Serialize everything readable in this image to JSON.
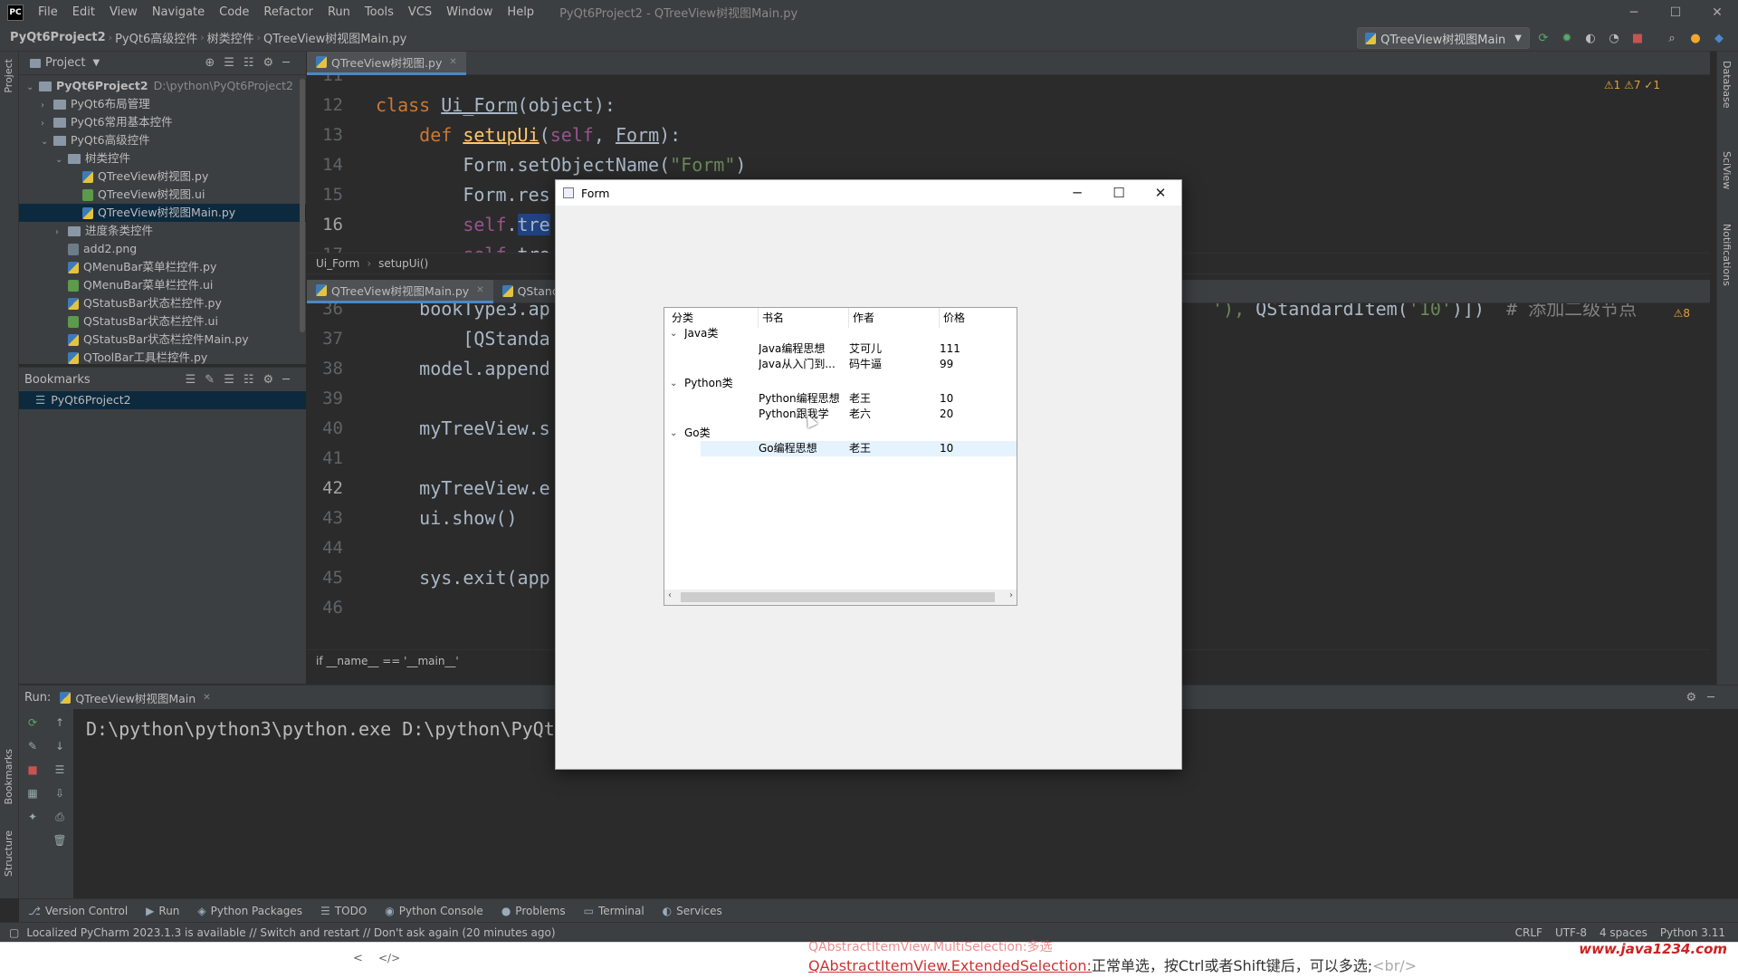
{
  "app": {
    "logo": "PC",
    "menus": [
      "File",
      "Edit",
      "View",
      "Navigate",
      "Code",
      "Refactor",
      "Run",
      "Tools",
      "VCS",
      "Window",
      "Help"
    ],
    "window_title": "PyQt6Project2 - QTreeView树视图Main.py"
  },
  "nav": {
    "breadcrumbs": [
      "PyQt6Project2",
      "PyQt6高级控件",
      "树类控件",
      "QTreeView树视图Main.py"
    ],
    "run_config": "QTreeView树视图Main"
  },
  "left_strip": {
    "project": "Project",
    "bookmarks": "Bookmarks",
    "structure": "Structure"
  },
  "right_strip": {
    "database": "Database",
    "sciview": "SciView",
    "notifications": "Notifications"
  },
  "project_panel": {
    "title": "Project",
    "items": [
      {
        "label": "PyQt6Project2",
        "extra": "D:\\python\\PyQt6Project2",
        "indent": 0,
        "type": "folder",
        "chev": "v"
      },
      {
        "label": "PyQt6布局管理",
        "indent": 1,
        "type": "folder",
        "chev": ">"
      },
      {
        "label": "PyQt6常用基本控件",
        "indent": 1,
        "type": "folder",
        "chev": ">"
      },
      {
        "label": "PyQt6高级控件",
        "indent": 1,
        "type": "folder",
        "chev": "v"
      },
      {
        "label": "树类控件",
        "indent": 2,
        "type": "folder",
        "chev": "v"
      },
      {
        "label": "QTreeView树视图.py",
        "indent": 3,
        "type": "py",
        "chev": ""
      },
      {
        "label": "QTreeView树视图.ui",
        "indent": 3,
        "type": "ui",
        "chev": ""
      },
      {
        "label": "QTreeView树视图Main.py",
        "indent": 3,
        "type": "py",
        "chev": "",
        "selected": true
      },
      {
        "label": "进度条类控件",
        "indent": 2,
        "type": "folder",
        "chev": ">"
      },
      {
        "label": "add2.png",
        "indent": 2,
        "type": "png",
        "chev": ""
      },
      {
        "label": "QMenuBar菜单栏控件.py",
        "indent": 2,
        "type": "py",
        "chev": ""
      },
      {
        "label": "QMenuBar菜单栏控件.ui",
        "indent": 2,
        "type": "ui",
        "chev": ""
      },
      {
        "label": "QStatusBar状态栏控件.py",
        "indent": 2,
        "type": "py",
        "chev": ""
      },
      {
        "label": "QStatusBar状态栏控件.ui",
        "indent": 2,
        "type": "ui",
        "chev": ""
      },
      {
        "label": "QStatusBar状态栏控件Main.py",
        "indent": 2,
        "type": "py",
        "chev": ""
      },
      {
        "label": "QToolBar工具栏控件.py",
        "indent": 2,
        "type": "py",
        "chev": ""
      }
    ]
  },
  "bookmarks": {
    "title": "Bookmarks",
    "items": [
      "PyQt6Project2"
    ]
  },
  "editor_top": {
    "tab": "QTreeView树视图.py",
    "lines": [
      {
        "n": "11",
        "html": ""
      },
      {
        "n": "12",
        "html": "<span class='kw'>class </span><span class='plain' style='text-decoration:underline'>Ui_Form</span><span class='plain'>(object):</span>"
      },
      {
        "n": "13",
        "html": "&nbsp;&nbsp;&nbsp;&nbsp;<span class='kw'>def </span><span class='fn' style='text-decoration:underline'>setupUi</span><span class='plain'>(</span><span class='self'>self</span><span class='plain'>, </span><span class='plain' style='text-decoration:underline'>Form</span><span class='plain'>):</span>"
      },
      {
        "n": "14",
        "html": "&nbsp;&nbsp;&nbsp;&nbsp;&nbsp;&nbsp;&nbsp;&nbsp;<span class='plain'>Form.setObjectName(</span><span class='str'>\"Form\"</span><span class='plain'>)</span>"
      },
      {
        "n": "15",
        "html": "&nbsp;&nbsp;&nbsp;&nbsp;&nbsp;&nbsp;&nbsp;&nbsp;<span class='plain'>Form.res</span>"
      },
      {
        "n": "16",
        "html": "&nbsp;&nbsp;&nbsp;&nbsp;&nbsp;&nbsp;&nbsp;&nbsp;<span class='self'>self</span><span class='plain'>.</span><span class='plain' style='background:#214283'>tre</span>"
      },
      {
        "n": "17",
        "html": "&nbsp;&nbsp;&nbsp;&nbsp;&nbsp;&nbsp;&nbsp;&nbsp;<span class='self'>self</span><span class='plain'>.tre</span>"
      }
    ],
    "crumbs": [
      "Ui_Form",
      "setupUi()"
    ],
    "inspections": "⚠1 ⚠7 ✓1"
  },
  "editor_bottom": {
    "tabs": [
      "QTreeView树视图Main.py",
      "QStanda"
    ],
    "lines": [
      {
        "n": "36",
        "html": "&nbsp;&nbsp;&nbsp;&nbsp;<span class='plain'>bookType3.ap</span>"
      },
      {
        "n": "37",
        "html": "&nbsp;&nbsp;&nbsp;&nbsp;&nbsp;&nbsp;&nbsp;&nbsp;<span class='plain'>[QStanda</span>"
      },
      {
        "n": "38",
        "html": "&nbsp;&nbsp;&nbsp;&nbsp;<span class='plain'>model.append</span>"
      },
      {
        "n": "39",
        "html": ""
      },
      {
        "n": "40",
        "html": "&nbsp;&nbsp;&nbsp;&nbsp;<span class='plain'>myTreeView.s</span>"
      },
      {
        "n": "41",
        "html": ""
      },
      {
        "n": "42",
        "html": "&nbsp;&nbsp;&nbsp;&nbsp;<span class='plain'>myTreeView.e</span>"
      },
      {
        "n": "43",
        "html": "&nbsp;&nbsp;&nbsp;&nbsp;<span class='plain'>ui.show()</span>"
      },
      {
        "n": "44",
        "html": ""
      },
      {
        "n": "45",
        "html": "&nbsp;&nbsp;&nbsp;&nbsp;<span class='plain'>sys.exit(app</span>"
      },
      {
        "n": "46",
        "html": ""
      }
    ],
    "right_code": "<span class='str'>'),</span><span class='plain'> QStandardItem(</span><span class='str'>'10'</span><span class='plain'>)])&nbsp;&nbsp;</span><span class='cm'># 添加二级节点</span>",
    "footer_crumb": "if __name__ == '__main__'",
    "inspections": "⚠8"
  },
  "run_panel": {
    "label": "Run:",
    "tab": "QTreeView树视图Main",
    "output": "D:\\python\\python3\\python.exe D:\\python\\PyQt"
  },
  "bottom_tabs": [
    "Version Control",
    "Run",
    "Python Packages",
    "TODO",
    "Python Console",
    "Problems",
    "Terminal",
    "Services"
  ],
  "status": {
    "message": "Localized PyCharm 2023.1.3 is available // Switch and restart // Don't ask again (20 minutes ago)",
    "right": [
      "CRLF",
      "UTF-8",
      "4 spaces",
      "Python 3.11"
    ]
  },
  "browser": {
    "text_main": "QAbstractItemView.ExtendedSelection:",
    "text_rest": "正常单选，按Ctrl或者Shift键后，可以多选;",
    "text_tag": "<br/>",
    "top_hint": "QAbstractItemView.MultiSelection:多选",
    "watermark": "www.java1234.com",
    "nav_left": "<",
    "nav_code": "</>"
  },
  "form_window": {
    "title": "Form",
    "headers": [
      "分类",
      "书名",
      "作者",
      "价格"
    ],
    "rows": [
      {
        "level": 0,
        "expander": "v",
        "cat": "Java类",
        "book": "",
        "author": "",
        "price": ""
      },
      {
        "level": 1,
        "cat": "",
        "book": "Java编程思想",
        "author": "艾可儿",
        "price": "111"
      },
      {
        "level": 1,
        "cat": "",
        "book": "Java从入门到...",
        "author": "码牛逼",
        "price": "99"
      },
      {
        "level": 0,
        "expander": "v",
        "cat": "Python类",
        "book": "",
        "author": "",
        "price": ""
      },
      {
        "level": 1,
        "cat": "",
        "book": "Python编程思想",
        "author": "老王",
        "price": "10"
      },
      {
        "level": 1,
        "cat": "",
        "book": "Python跟我学",
        "author": "老六",
        "price": "20"
      },
      {
        "level": 0,
        "expander": "v",
        "cat": "Go类",
        "book": "",
        "author": "",
        "price": ""
      },
      {
        "level": 1,
        "cat": "",
        "book": "Go编程思想",
        "author": "老王",
        "price": "10",
        "selected": true
      }
    ]
  }
}
